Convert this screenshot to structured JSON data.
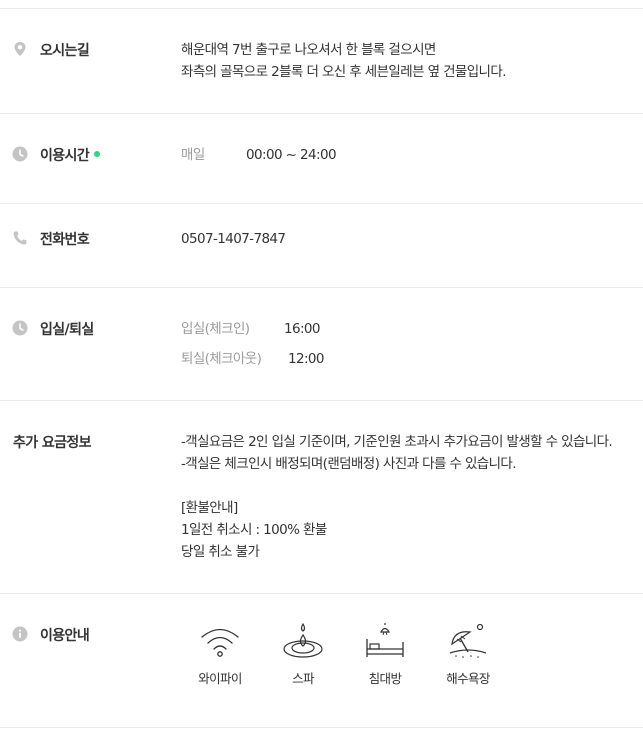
{
  "location": {
    "label": "오시는길",
    "icon": "location-pin-icon",
    "lines": [
      "해운대역 7번 출구로 나오셔서 한 블록 걸으시면",
      "좌측의 골목으로 2블록 더 오신 후 세븐일레븐 옆 건물입니다."
    ]
  },
  "hours": {
    "label": "이용시간",
    "icon": "clock-icon",
    "status_color": "#2fd47c",
    "day": "매일",
    "time": "00:00 ~ 24:00"
  },
  "phone": {
    "label": "전화번호",
    "icon": "phone-icon",
    "number": "0507-1407-7847"
  },
  "checkin": {
    "label": "입실/퇴실",
    "icon": "clock-icon",
    "in_label": "입실(체크인)",
    "in_time": "16:00",
    "out_label": "퇴실(체크아웃)",
    "out_time": "12:00"
  },
  "fees": {
    "label": "추가 요금정보",
    "lines": [
      "-객실요금은 2인 입실 기준이며, 기준인원 초과시 추가요금이 발생할 수 있습니다.",
      "-객실은 체크인시 배정되며(랜덤배정) 사진과 다를 수 있습니다.",
      "",
      "[환불안내]",
      "1일전 취소시 : 100% 환불",
      "당일 취소 불가"
    ]
  },
  "amenities": {
    "label": "이용안내",
    "icon": "info-icon",
    "items": [
      {
        "label": "와이파이",
        "icon": "wifi-icon"
      },
      {
        "label": "스파",
        "icon": "spa-icon"
      },
      {
        "label": "침대방",
        "icon": "bed-icon"
      },
      {
        "label": "해수욕장",
        "icon": "beach-icon"
      }
    ]
  }
}
